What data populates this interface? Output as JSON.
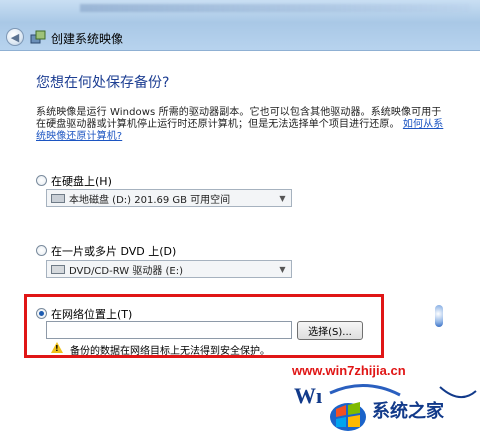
{
  "window": {
    "title": "创建系统映像"
  },
  "heading": "您想在何处保存备份?",
  "description": {
    "text": "系统映像是运行 Windows 所需的驱动器副本。它也可以包含其他驱动器。系统映像可用于在硬盘驱动器或计算机停止运行时还原计算机；但是无法选择单个项目进行还原。",
    "link": "如何从系统映像还原计算机?"
  },
  "options": {
    "hard_disk": {
      "label": "在硬盘上(H)",
      "selected_value": "本地磁盘 (D:)  201.69 GB 可用空间"
    },
    "dvd": {
      "label": "在一片或多片 DVD 上(D)",
      "selected_value": "DVD/CD-RW 驱动器 (E:)"
    },
    "network": {
      "label": "在网络位置上(T)",
      "input_value": "",
      "browse_label": "选择(S)...",
      "warning": "备份的数据在网络目标上无法得到安全保护。"
    }
  },
  "watermark": {
    "url": "www.win7zhijia.cn",
    "brand": "系统之家"
  },
  "colors": {
    "highlight": "#e01616",
    "heading": "#1e3f93",
    "link": "#1c55c2"
  }
}
